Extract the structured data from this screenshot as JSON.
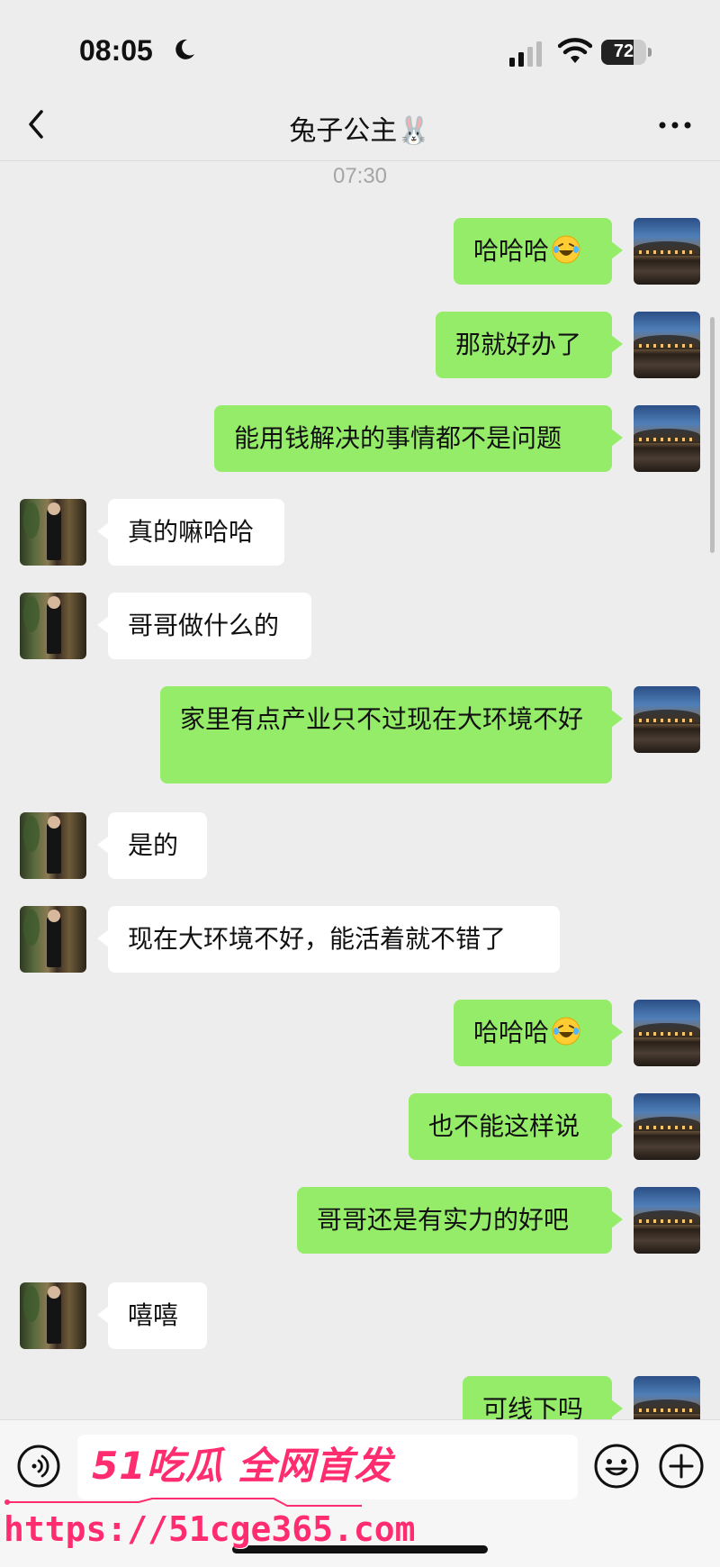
{
  "status_bar": {
    "time": "08:05",
    "battery": "72",
    "battery_level": 0.72
  },
  "header": {
    "title": "兔子公主🐰"
  },
  "timestamp": "07:30",
  "messages": [
    {
      "from": "me",
      "text": "哈哈哈",
      "emoji": "laughing-tears-emoji"
    },
    {
      "from": "me",
      "text": "那就好办了"
    },
    {
      "from": "me",
      "text": "能用钱解决的事情都不是问题"
    },
    {
      "from": "her",
      "text": "真的嘛哈哈"
    },
    {
      "from": "her",
      "text": "哥哥做什么的"
    },
    {
      "from": "me",
      "text": "家里有点产业只不过现在大环境不好"
    },
    {
      "from": "her",
      "text": "是的"
    },
    {
      "from": "her",
      "text": "现在大环境不好，能活着就不错了"
    },
    {
      "from": "me",
      "text": "哈哈哈",
      "emoji": "laughing-tears-emoji"
    },
    {
      "from": "me",
      "text": "也不能这样说"
    },
    {
      "from": "me",
      "text": "哥哥还是有实力的好吧"
    },
    {
      "from": "her",
      "text": "嘻嘻"
    },
    {
      "from": "me",
      "text": "可线下吗"
    }
  ],
  "input_bar": {
    "placeholder": ""
  },
  "watermark": {
    "brand": "51吃瓜 全网首发",
    "url": "https://51cge365.com"
  },
  "colors": {
    "my_bubble": "#95ec69",
    "her_bubble": "#ffffff",
    "background": "#ededed",
    "watermark": "#ff2d6f"
  }
}
